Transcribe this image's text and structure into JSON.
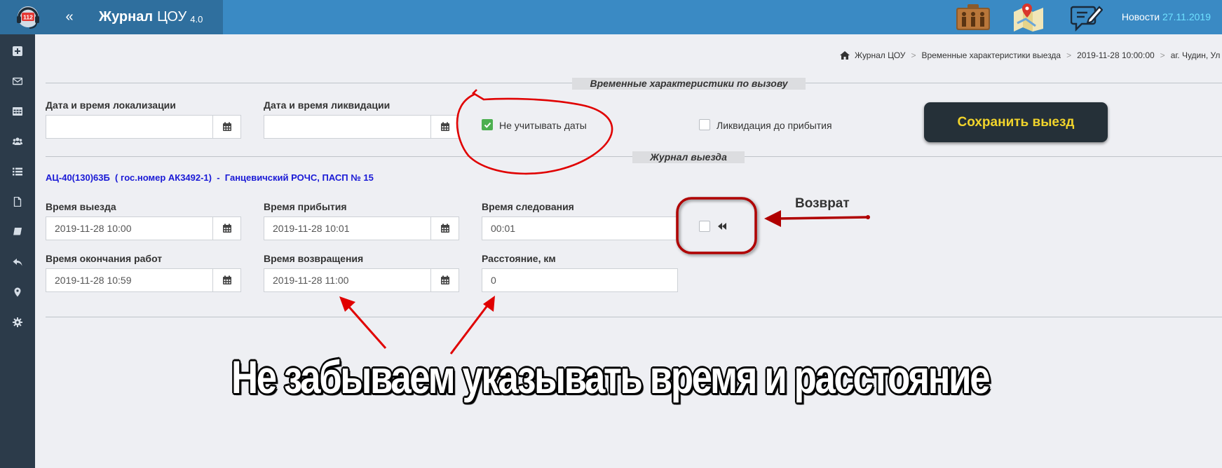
{
  "header": {
    "logo_text": "112",
    "collapse_label": "«",
    "brand_title": "Журнал",
    "brand_subtitle": "ЦОУ",
    "brand_version": "4.0",
    "news_label": "Новости",
    "news_date": "27.11.2019"
  },
  "sidebar": {
    "items": [
      {
        "icon": "plus-square-icon"
      },
      {
        "icon": "envelope-icon"
      },
      {
        "icon": "table-icon"
      },
      {
        "icon": "users-icon"
      },
      {
        "icon": "list-icon"
      },
      {
        "icon": "file-icon"
      },
      {
        "icon": "book-icon"
      },
      {
        "icon": "reply-icon"
      },
      {
        "icon": "map-marker-icon"
      },
      {
        "icon": "gear-icon"
      }
    ]
  },
  "breadcrumb": {
    "items": [
      "Журнал ЦОУ",
      "Временные характеристики выезда",
      "2019-11-28 10:00:00",
      "аг. Чудин, Ул"
    ]
  },
  "section_call": {
    "title": "Временные характеристики по вызову",
    "localization_label": "Дата и время локализации",
    "localization_value": "",
    "liquidation_label": "Дата и время ликвидации",
    "liquidation_value": "",
    "ignore_dates_label": "Не учитывать даты",
    "ignore_dates_checked": true,
    "liquidation_before_label": "Ликвидация до прибытия",
    "liquidation_before_checked": false,
    "save_button_label": "Сохранить выезд"
  },
  "section_trip": {
    "title": "Журнал выезда",
    "vehicle_info": "АЦ-40(130)63Б  ( гос.номер АК3492-1)  -  Ганцевичский РОЧС, ПАСП № 15",
    "departure_label": "Время выезда",
    "departure_value": "2019-11-28 10:00",
    "arrival_label": "Время прибытия",
    "arrival_value": "2019-11-28 10:01",
    "travel_label": "Время следования",
    "travel_value": "00:01",
    "work_end_label": "Время окончания работ",
    "work_end_value": "2019-11-28 10:59",
    "return_label": "Время возвращения",
    "return_value": "2019-11-28 11:00",
    "distance_label": "Расстояние, км",
    "distance_value": "0",
    "return_checkbox_checked": false
  },
  "annotations": {
    "return_note": "Возврат",
    "caption": "Не забываем указывать время и расстояние",
    "color": "#e00000"
  }
}
